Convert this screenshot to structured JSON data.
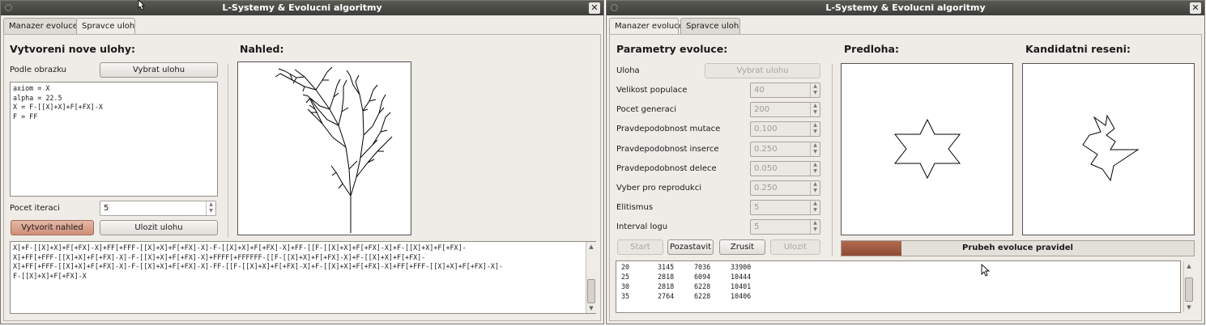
{
  "left_window": {
    "title": "L-Systemy & Evolucni algoritmy",
    "close_glyph": "✕",
    "tabs": [
      {
        "label": "Manazer evoluce"
      },
      {
        "label": "Spravce uloh"
      }
    ],
    "active_tab": 1,
    "create_heading": "Vytvoreni nove ulohy:",
    "preview_heading": "Nahled:",
    "from_image_label": "Podle obrazku",
    "select_task_button": "Vybrat ulohu",
    "definition": "axiom = X\nalpha = 22.5\nX = F-[[X]+X]+F[+FX]-X\nF = FF",
    "iterations_label": "Pocet iteraci",
    "iterations_value": "5",
    "create_preview_button": "Vytvorit nahled",
    "save_task_button": "Ulozit ulohu",
    "output_text": "X]+F-[[X]+X]+F[+FX]-X]+FF[+FFF-[[X]+X]+F[+FX]-X]-F-[[X]+X]+F[+FX]-X]+FF-[[F-[[X]+X]+F[+FX]-X]+F-[[X]+X]+F[+FX]-\nX]+FF[+FFF-[[X]+X]+F[+FX]-X]-F-[[X]+X]+F[+FX]-X]+FFFF[+FFFFFF-[[F-[[X]+X]+F[+FX]-X]+F-[[X]+X]+F[+FX]-\nX]+FF[+FFF-[[X]+X]+F[+FX]-X]-F-[[X]+X]+F[+FX]-X]-FF-[[F-[[X]+X]+F[+FX]-X]+F-[[X]+X]+F[+FX]-X]+FF[+FFF-[[X]+X]+F[+FX]-X]-\nF-[[X]+X]+F[+FX]-X"
  },
  "right_window": {
    "title": "L-Systemy & Evolucni algoritmy",
    "close_glyph": "✕",
    "tabs": [
      {
        "label": "Manazer evoluce"
      },
      {
        "label": "Spravce uloh"
      }
    ],
    "active_tab": 0,
    "params_heading": "Parametry evoluce:",
    "template_heading": "Predloha:",
    "candidate_heading": "Kandidatni reseni:",
    "task_label": "Uloha",
    "select_task_button": "Vybrat ulohu",
    "params": [
      {
        "label": "Velikost populace",
        "value": "40"
      },
      {
        "label": "Pocet generaci",
        "value": "200"
      },
      {
        "label": "Pravdepodobnost mutace",
        "value": "0.100"
      },
      {
        "label": "Pravdepodobnost inserce",
        "value": "0.250"
      },
      {
        "label": "Pravdepodobnost delece",
        "value": "0.050"
      },
      {
        "label": "Vyber pro reprodukci",
        "value": "0.250"
      },
      {
        "label": "Elitismus",
        "value": "5"
      },
      {
        "label": "Interval logu",
        "value": "5"
      }
    ],
    "buttons": {
      "start": "Start",
      "pause": "Pozastavit",
      "cancel": "Zrusit",
      "save": "Ulozit"
    },
    "progress_label": "Prubeh evoluce pravidel",
    "progress_fraction": 0.17,
    "log": [
      [
        "20",
        "3145",
        "7036",
        "33900"
      ],
      [
        "25",
        "2818",
        "6094",
        "10444"
      ],
      [
        "30",
        "2818",
        "6228",
        "10401"
      ],
      [
        "35",
        "2764",
        "6228",
        "10406"
      ]
    ]
  },
  "colors": {
    "progress_fill": "#a35c43",
    "create_button": "#d69c88"
  }
}
